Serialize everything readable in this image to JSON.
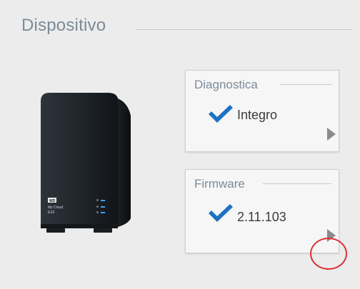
{
  "panel": {
    "title": "Dispositivo"
  },
  "device": {
    "brand": "WD",
    "model_line1": "My Cloud",
    "model_line2": "EX2"
  },
  "diagnostics": {
    "label": "Diagnostica",
    "status": "Integro",
    "status_icon": "checkmark-icon",
    "nav_icon": "arrow-right-icon"
  },
  "firmware": {
    "label": "Firmware",
    "version": "2.11.103",
    "status_icon": "checkmark-icon",
    "nav_icon": "arrow-right-icon"
  },
  "colors": {
    "title": "#7c8b98",
    "check": "#1d72c1",
    "highlight": "#e03030"
  }
}
